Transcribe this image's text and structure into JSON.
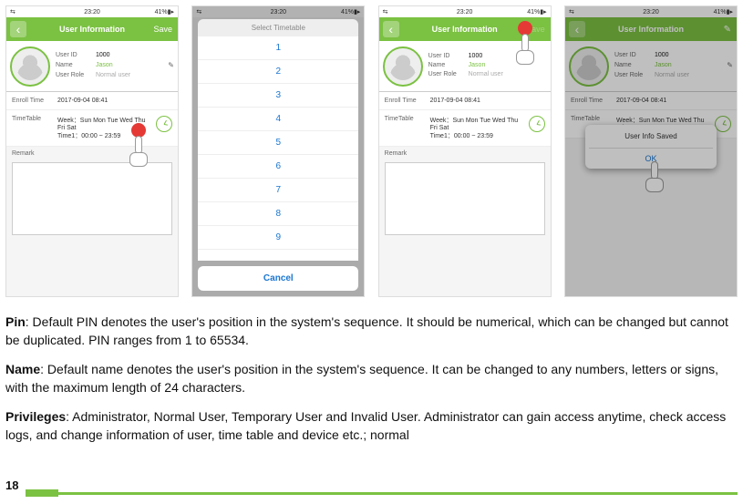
{
  "status": {
    "time": "23:20",
    "battery": "41%",
    "signal": "⇆",
    "bt": "✽"
  },
  "header": {
    "title": "User Information",
    "save": "Save",
    "edit": "✎"
  },
  "profile": {
    "fields": {
      "id_label": "User ID",
      "id_value": "1000",
      "name_label": "Name",
      "name_value": "Jason",
      "role_label": "User Role",
      "role_value": "Normal user"
    }
  },
  "enroll": {
    "label": "Enroll Time",
    "value": "2017-09-04 08:41"
  },
  "timetable": {
    "label": "TimeTable",
    "week_label": "Week：",
    "week_value": "Sun Mon Tue Wed Thu Fri Sat",
    "time_label": "Time1：",
    "time_value": "00:00 ~ 23:59"
  },
  "remark": {
    "label": "Remark"
  },
  "picker": {
    "title": "Select Timetable",
    "items": [
      "1",
      "2",
      "3",
      "4",
      "5",
      "6",
      "7",
      "8",
      "9"
    ],
    "cancel": "Cancel"
  },
  "alert": {
    "title": "User Info Saved",
    "ok": "OK"
  },
  "body": {
    "pin_label": "Pin",
    "pin_text": ": Default PIN denotes the user's position in the system's sequence. It should be numerical, which can be changed but cannot be duplicated. PIN ranges from 1 to 65534.",
    "name_label": "Name",
    "name_text": ": Default name denotes the user's position in the system's sequence. It can be changed to any numbers, letters or signs, with the maximum length of 24 characters.",
    "priv_label": "Privileges",
    "priv_text": ": Administrator, Normal User, Temporary User and Invalid User. Administrator can gain access anytime, check access logs, and change information of user, time table and device etc.; normal"
  },
  "page_number": "18"
}
